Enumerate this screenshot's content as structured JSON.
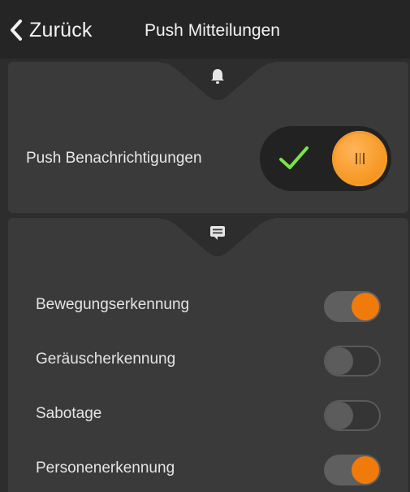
{
  "header": {
    "back_label": "Zurück",
    "title": "Push Mitteilungen"
  },
  "push_card": {
    "icon": "bell-icon",
    "label": "Push Benachrichtigungen",
    "toggle_on": true
  },
  "detection_card": {
    "icon": "message-icon",
    "items": [
      {
        "label": "Bewegungserkennung",
        "on": true
      },
      {
        "label": "Geräuscherkennung",
        "on": false
      },
      {
        "label": "Sabotage",
        "on": false
      },
      {
        "label": "Personenerkennung",
        "on": true
      }
    ]
  },
  "colors": {
    "accent_orange": "#f07a0a",
    "check_green": "#7be34a",
    "background": "#2d2d2d",
    "card": "#3a3a3a"
  }
}
